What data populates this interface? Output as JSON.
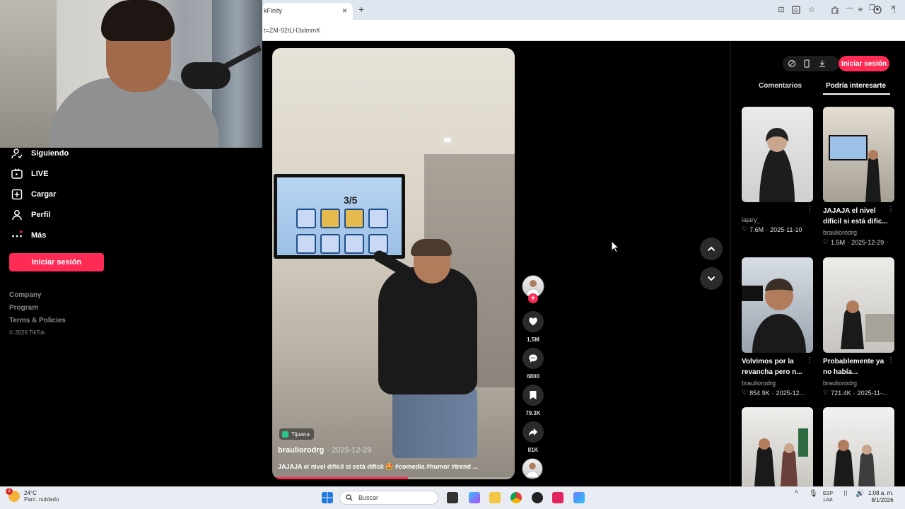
{
  "browser": {
    "tab_title": "kFinity",
    "tab_close": "×",
    "new_tab": "+",
    "url": "t=ZM-92tLH3xlmmK",
    "window_min": "—",
    "window_max": "❐",
    "window_close": "✕"
  },
  "sidebar": {
    "items": [
      {
        "label": "Siguiendo",
        "icon": "following-icon"
      },
      {
        "label": "LIVE",
        "icon": "live-icon"
      },
      {
        "label": "Cargar",
        "icon": "upload-icon"
      },
      {
        "label": "Perfil",
        "icon": "profile-icon"
      },
      {
        "label": "Más",
        "icon": "more-icon"
      }
    ],
    "login_button": "Iniciar sesión",
    "footer_links": [
      "Company",
      "Program",
      "Terms & Policies"
    ],
    "copyright": "© 2026 TikTok"
  },
  "video": {
    "tv_score": "3/5",
    "location": "Tijuana",
    "author": "brauliorodrg",
    "date": "· 2025-12-29",
    "caption": "JAJAJA el nivel difícil si está difícil 🤩 #comedia #humor #trend ...",
    "progress": 0.56
  },
  "actions": {
    "follow": "+",
    "likes": "1.5M",
    "comments": "6800",
    "saves": "79.3K",
    "shares": "81K"
  },
  "right_panel": {
    "login_button": "Iniciar sesión",
    "tabs": [
      "Comentarios",
      "Podría interesarte"
    ],
    "active_tab": "Podría interesarte",
    "videos": [
      {
        "title": "",
        "author": "lajary_",
        "likes": "7.6M",
        "date": "2025-11-10"
      },
      {
        "title": "JAJAJA el nivel difícil si está difíc...",
        "author": "brauliorodrg",
        "likes": "1.5M",
        "date": "2025-12-29"
      },
      {
        "title": "Volvimos por la revancha pero n...",
        "author": "brauliorodrg",
        "likes": "854.9K",
        "date": "2025-12..."
      },
      {
        "title": "Probablemente ya no había...",
        "author": "brauliorodrg",
        "likes": "721.4K",
        "date": "2025-11-..."
      }
    ]
  },
  "taskbar": {
    "weather_badge": "2",
    "temperature": "24°C",
    "condition": "Parc. nublado",
    "search_placeholder": "Buscar",
    "lang_top": "ESP",
    "lang_bottom": "LAA",
    "time": "1:08 a. m.",
    "date": "8/1/2026"
  },
  "colors": {
    "accent": "#fe2c55",
    "background": "#000000"
  }
}
